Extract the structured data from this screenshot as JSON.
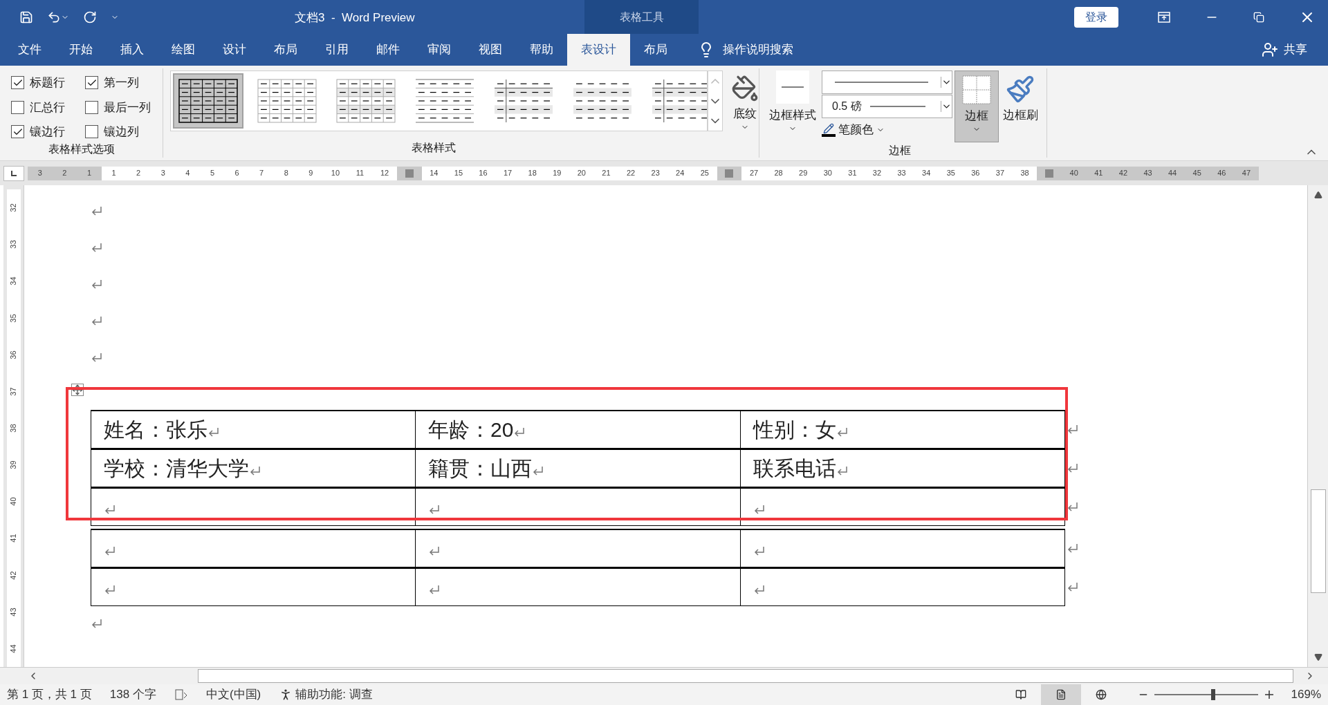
{
  "window": {
    "title": "文档3  -  Word Preview",
    "context_tab": "表格工具",
    "login": "登录"
  },
  "menu_tabs": [
    {
      "label": "文件",
      "selected": false
    },
    {
      "label": "开始",
      "selected": false
    },
    {
      "label": "插入",
      "selected": false
    },
    {
      "label": "绘图",
      "selected": false
    },
    {
      "label": "设计",
      "selected": false
    },
    {
      "label": "布局",
      "selected": false
    },
    {
      "label": "引用",
      "selected": false
    },
    {
      "label": "邮件",
      "selected": false
    },
    {
      "label": "审阅",
      "selected": false
    },
    {
      "label": "视图",
      "selected": false
    },
    {
      "label": "帮助",
      "selected": false
    },
    {
      "label": "表设计",
      "selected": true
    },
    {
      "label": "布局",
      "selected": false
    }
  ],
  "search_hint": "操作说明搜索",
  "share": "共享",
  "style_options": {
    "group_label": "表格样式选项",
    "checkboxes": [
      {
        "label": "标题行",
        "checked": true
      },
      {
        "label": "第一列",
        "checked": true
      },
      {
        "label": "汇总行",
        "checked": false
      },
      {
        "label": "最后一列",
        "checked": false
      },
      {
        "label": "镶边行",
        "checked": true
      },
      {
        "label": "镶边列",
        "checked": false
      }
    ]
  },
  "table_styles": {
    "group_label": "表格样式",
    "gallery": [
      {
        "kind": "grid",
        "selected": true
      },
      {
        "kind": "light-grid",
        "selected": false
      },
      {
        "kind": "banded-grid",
        "selected": false
      },
      {
        "kind": "lines",
        "selected": false
      },
      {
        "kind": "first-column",
        "selected": false
      },
      {
        "kind": "banded",
        "selected": false
      },
      {
        "kind": "first-column",
        "selected": false
      }
    ]
  },
  "shading": {
    "label": "底纹"
  },
  "borders": {
    "group_label": "边框",
    "border_styles_label": "边框样式",
    "pen_weight": "0.5 磅",
    "pen_color_label": "笔颜色",
    "borders_button": {
      "label": "边框",
      "selected": true
    },
    "border_painter": "边框刷"
  },
  "ruler": {
    "segments": [
      {
        "kind": "margin",
        "labels": [
          "3",
          "2",
          "1"
        ]
      },
      {
        "kind": "column",
        "labels": [
          "1",
          "2",
          "3",
          "4",
          "5",
          "6",
          "7",
          "8",
          "9",
          "10",
          "11",
          "12"
        ]
      },
      {
        "kind": "marker"
      },
      {
        "kind": "column",
        "labels": [
          "14",
          "15",
          "16",
          "17",
          "18",
          "19",
          "20",
          "21",
          "22",
          "23",
          "24",
          "25"
        ]
      },
      {
        "kind": "marker"
      },
      {
        "kind": "column",
        "labels": [
          "27",
          "28",
          "29",
          "30",
          "31",
          "32",
          "33",
          "34",
          "35",
          "36",
          "37",
          "38"
        ]
      },
      {
        "kind": "marker"
      },
      {
        "kind": "margin",
        "labels": [
          "40",
          "41",
          "42",
          "43",
          "44",
          "45",
          "46",
          "47"
        ]
      }
    ]
  },
  "vertical_ruler": {
    "labels": [
      "32",
      "33",
      "34",
      "35",
      "36",
      "37",
      "38",
      "39",
      "40",
      "41",
      "42",
      "43",
      "44"
    ]
  },
  "table": {
    "rows": [
      {
        "cells": [
          "姓名：张乐",
          "年龄：20",
          "性别：女"
        ]
      },
      {
        "cells": [
          "学校：清华大学",
          "籍贯：山西",
          "联系电话"
        ]
      }
    ]
  },
  "status_bar": {
    "page": "第 1 页，共 1 页",
    "words": "138 个字",
    "language": "中文(中国)",
    "accessibility": "辅助功能: 调查",
    "views": [
      {
        "kind": "read",
        "selected": false
      },
      {
        "kind": "print",
        "selected": true
      },
      {
        "kind": "web",
        "selected": false
      }
    ],
    "zoom": {
      "level": 0.57,
      "reading": "169%"
    }
  }
}
